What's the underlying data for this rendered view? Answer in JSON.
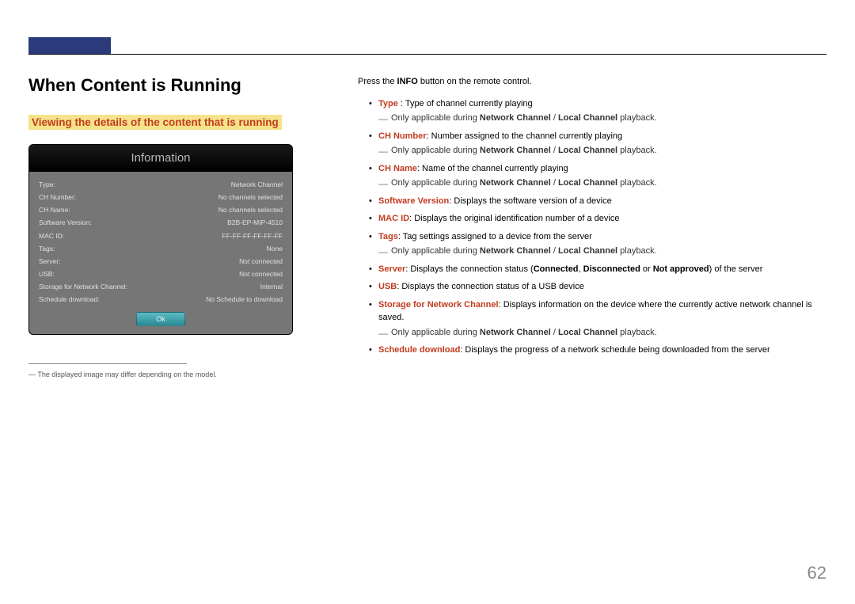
{
  "page_number": "62",
  "heading": "When Content is Running",
  "subheading": "Viewing the details of the content that is running",
  "dialog": {
    "title": "Information",
    "rows": [
      {
        "label": "Type:",
        "value": "Network Channel"
      },
      {
        "label": "CH Number:",
        "value": "No channels selected"
      },
      {
        "label": "CH Name:",
        "value": "No channels selected"
      },
      {
        "label": "Software Version:",
        "value": "B2B-EP-MIP-4510"
      },
      {
        "label": "MAC ID:",
        "value": "FF-FF-FF-FF-FF-FF"
      },
      {
        "label": "Tags:",
        "value": "None"
      },
      {
        "label": "Server:",
        "value": "Not connected"
      },
      {
        "label": "USB:",
        "value": "Not connected"
      },
      {
        "label": "Storage for Network Channel:",
        "value": "Internal"
      },
      {
        "label": "Schedule download:",
        "value": "No Schedule to download"
      }
    ],
    "button": "Ok"
  },
  "footnote": "The displayed image may differ depending on the model.",
  "intro": {
    "pre": "Press the ",
    "bold": "INFO",
    "post": " button on the remote control."
  },
  "items": {
    "type_label": "Type",
    "type_desc": " : Type of channel currently playing",
    "chnum_label": "CH Number",
    "chnum_desc": ": Number assigned to the channel currently playing",
    "chname_label": "CH Name",
    "chname_desc": ": Name of the channel currently playing",
    "sw_label": "Software Version",
    "sw_desc": ": Displays the software version of a device",
    "mac_label": "MAC ID",
    "mac_desc": ": Displays the original identification number of a device",
    "tags_label": "Tags",
    "tags_desc": ": Tag settings assigned to a device from the server",
    "server_label": "Server",
    "server_pre": ": Displays the connection status (",
    "server_c": "Connected",
    "server_s1": ", ",
    "server_d": "Disconnected",
    "server_s2": " or ",
    "server_n": "Not approved",
    "server_post": ") of the server",
    "usb_label": "USB",
    "usb_desc": ": Displays the connection status of a USB device",
    "storage_label": "Storage for Network Channel",
    "storage_desc": ": Displays information on the device where the currently active network channel is saved.",
    "sched_label": "Schedule download",
    "sched_desc": ": Displays the progress of a network schedule being downloaded from the server"
  },
  "applic": {
    "pre": "Only applicable during ",
    "n": "Network Channel",
    "sep": " / ",
    "l": "Local Channel",
    "post": " playback."
  }
}
